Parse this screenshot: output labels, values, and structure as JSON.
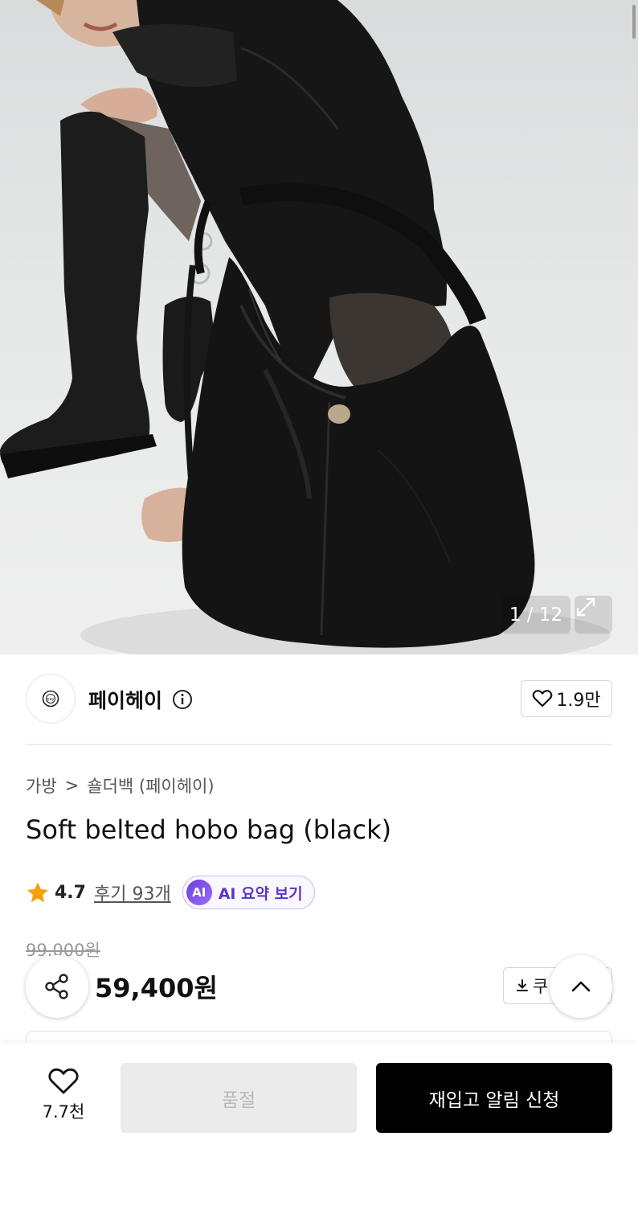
{
  "gallery": {
    "counter": "1 / 12"
  },
  "brand": {
    "name": "페이헤이",
    "logo_text": "pay"
  },
  "like": {
    "count": "1.9만"
  },
  "breadcrumb": {
    "category": "가방",
    "separator": ">",
    "subcategory": "숄더백 (페이헤이)"
  },
  "product": {
    "title": "Soft belted hobo bag (black)"
  },
  "rating": {
    "value": "4.7",
    "reviews": "후기 93개",
    "ai_badge": "AI",
    "ai_label": "AI 요약 보기",
    "star_color": "#f5a000"
  },
  "price": {
    "original": "99,000원",
    "sale": "59,400원",
    "coupon_label": "쿠"
  },
  "bottom": {
    "wish_count": "7.7천",
    "soldout_label": "품절",
    "restock_label": "재입고 알림 신청"
  },
  "icons": [
    "expand-icon",
    "info-icon",
    "heart-icon",
    "star-icon",
    "share-icon",
    "download-icon",
    "chevron-up-icon"
  ],
  "colors": {
    "accent_purple": "#5b35c9",
    "primary_button": "#000000",
    "disabled_button": "#ebebeb"
  }
}
